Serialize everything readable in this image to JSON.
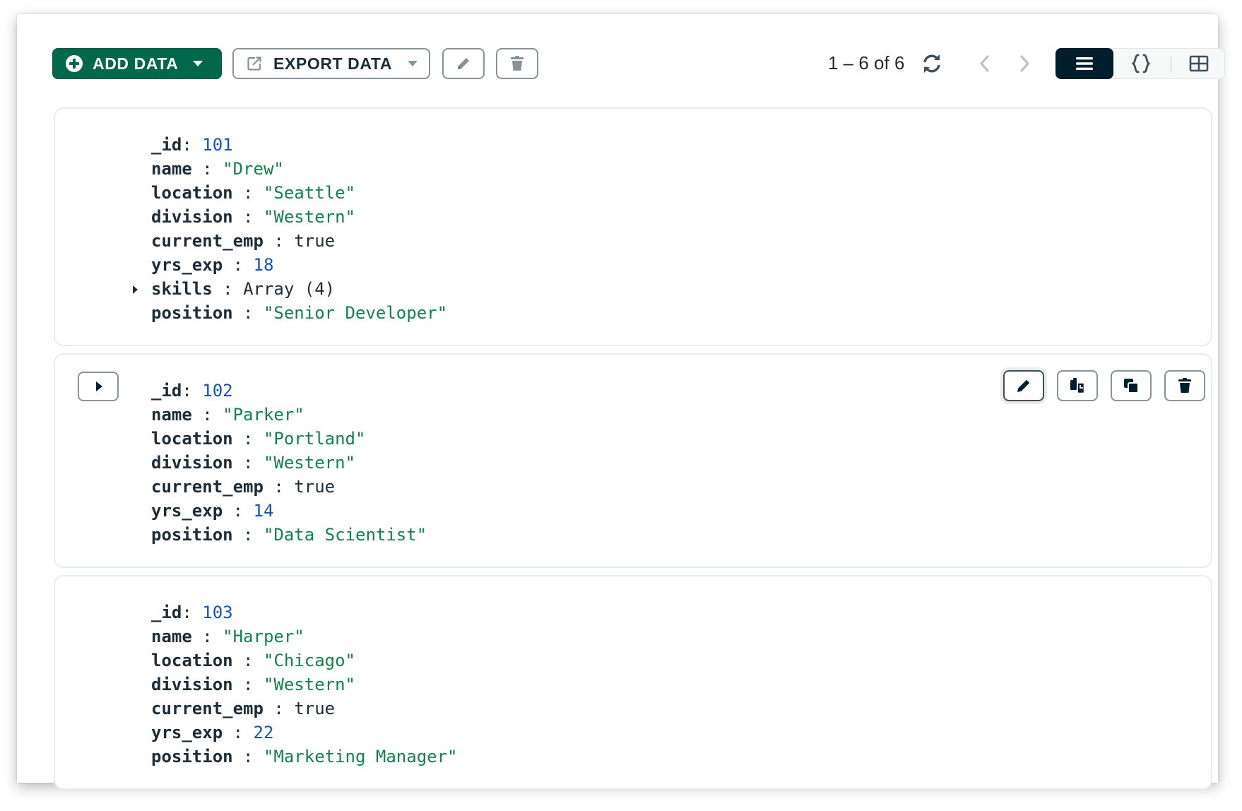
{
  "toolbar": {
    "add_label": "ADD DATA",
    "export_label": "EXPORT DATA",
    "pagination": "1 – 6 of 6"
  },
  "colors": {
    "primary_green": "#00684a",
    "dark_navy": "#001e2b",
    "key_text": "#1c2d38",
    "number_value": "#1254b7",
    "string_value": "#12824d",
    "border_gray": "#889397"
  },
  "icons": [
    "plus-circle-icon",
    "caret-down-icon",
    "export-icon",
    "pencil-icon",
    "trash-icon",
    "refresh-icon",
    "chevron-left-icon",
    "chevron-right-icon",
    "list-view-icon",
    "json-view-icon",
    "table-view-icon",
    "caret-right-icon",
    "copy-icon",
    "clone-icon"
  ],
  "documents": [
    {
      "fields": [
        {
          "key": "_id",
          "sep": ": ",
          "value": "101",
          "type": "num"
        },
        {
          "key": "name",
          "sep": " : ",
          "value": "\"Drew\"",
          "type": "str"
        },
        {
          "key": "location",
          "sep": " : ",
          "value": "\"Seattle\"",
          "type": "str"
        },
        {
          "key": "division",
          "sep": " : ",
          "value": "\"Western\"",
          "type": "str"
        },
        {
          "key": "current_emp",
          "sep": " : ",
          "value": "true",
          "type": "bool"
        },
        {
          "key": "yrs_exp",
          "sep": " : ",
          "value": "18",
          "type": "num"
        },
        {
          "key": "skills",
          "sep": " : ",
          "value": "Array (4)",
          "type": "arr"
        },
        {
          "key": "position",
          "sep": " : ",
          "value": "\"Senior Developer\"",
          "type": "str"
        }
      ]
    },
    {
      "fields": [
        {
          "key": "_id",
          "sep": ": ",
          "value": "102",
          "type": "num"
        },
        {
          "key": "name",
          "sep": " : ",
          "value": "\"Parker\"",
          "type": "str"
        },
        {
          "key": "location",
          "sep": " : ",
          "value": "\"Portland\"",
          "type": "str"
        },
        {
          "key": "division",
          "sep": " : ",
          "value": "\"Western\"",
          "type": "str"
        },
        {
          "key": "current_emp",
          "sep": " : ",
          "value": "true",
          "type": "bool"
        },
        {
          "key": "yrs_exp",
          "sep": " : ",
          "value": "14",
          "type": "num"
        },
        {
          "key": "position",
          "sep": " : ",
          "value": "\"Data Scientist\"",
          "type": "str"
        }
      ]
    },
    {
      "fields": [
        {
          "key": "_id",
          "sep": ": ",
          "value": "103",
          "type": "num"
        },
        {
          "key": "name",
          "sep": " : ",
          "value": "\"Harper\"",
          "type": "str"
        },
        {
          "key": "location",
          "sep": " : ",
          "value": "\"Chicago\"",
          "type": "str"
        },
        {
          "key": "division",
          "sep": " : ",
          "value": "\"Western\"",
          "type": "str"
        },
        {
          "key": "current_emp",
          "sep": " : ",
          "value": "true",
          "type": "bool"
        },
        {
          "key": "yrs_exp",
          "sep": " : ",
          "value": "22",
          "type": "num"
        },
        {
          "key": "position",
          "sep": " : ",
          "value": "\"Marketing Manager\"",
          "type": "str"
        }
      ]
    }
  ]
}
